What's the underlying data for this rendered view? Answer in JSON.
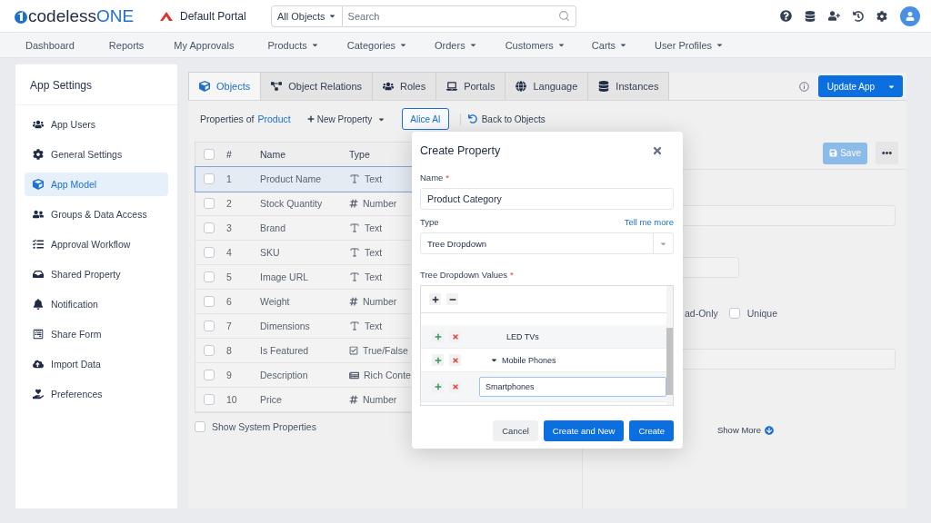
{
  "header": {
    "logo": {
      "main": "codeless",
      "accent": "ONE"
    },
    "portal": "Default Portal",
    "search": {
      "scope": "All Objects",
      "placeholder": "Search"
    }
  },
  "nav": [
    {
      "label": "Dashboard",
      "dropdown": false
    },
    {
      "label": "Reports",
      "dropdown": false
    },
    {
      "label": "My Approvals",
      "dropdown": false
    },
    {
      "label": "Products",
      "dropdown": true
    },
    {
      "label": "Categories",
      "dropdown": true
    },
    {
      "label": "Orders",
      "dropdown": true
    },
    {
      "label": "Customers",
      "dropdown": true
    },
    {
      "label": "Carts",
      "dropdown": true
    },
    {
      "label": "User Profiles",
      "dropdown": true
    }
  ],
  "sidebar": {
    "title": "App Settings",
    "items": [
      {
        "label": "App Users",
        "selected": false
      },
      {
        "label": "General Settings",
        "selected": false
      },
      {
        "label": "App Model",
        "selected": true
      },
      {
        "label": "Groups & Data Access",
        "selected": false
      },
      {
        "label": "Approval Workflow",
        "selected": false
      },
      {
        "label": "Shared Property",
        "selected": false
      },
      {
        "label": "Notification",
        "selected": false
      },
      {
        "label": "Share Form",
        "selected": false
      },
      {
        "label": "Import Data",
        "selected": false
      },
      {
        "label": "Preferences",
        "selected": false
      }
    ]
  },
  "tabs": [
    {
      "label": "Objects",
      "selected": true
    },
    {
      "label": "Object Relations",
      "selected": false
    },
    {
      "label": "Roles",
      "selected": false
    },
    {
      "label": "Portals",
      "selected": false
    },
    {
      "label": "Language",
      "selected": false
    },
    {
      "label": "Instances",
      "selected": false
    }
  ],
  "update_button": "Update App",
  "toolbar": {
    "prefix": "Properties of",
    "object": "Product",
    "new_property": "New Property",
    "ai_button": "Alice AI",
    "back": "Back to Objects"
  },
  "table": {
    "all_checked": false,
    "columns": [
      "#",
      "Name",
      "Type"
    ],
    "rows": [
      {
        "index": "1",
        "name": "Product Name",
        "type": "Text",
        "kind": "text",
        "checked": false,
        "selected": true
      },
      {
        "index": "2",
        "name": "Stock Quantity",
        "type": "Number",
        "kind": "number",
        "checked": false,
        "selected": false
      },
      {
        "index": "3",
        "name": "Brand",
        "type": "Text",
        "kind": "text",
        "checked": false,
        "selected": false
      },
      {
        "index": "4",
        "name": "SKU",
        "type": "Text",
        "kind": "text",
        "checked": false,
        "selected": false
      },
      {
        "index": "5",
        "name": "Image URL",
        "type": "Text",
        "kind": "text",
        "checked": false,
        "selected": false
      },
      {
        "index": "6",
        "name": "Weight",
        "type": "Number",
        "kind": "number",
        "checked": false,
        "selected": false
      },
      {
        "index": "7",
        "name": "Dimensions",
        "type": "Text",
        "kind": "text",
        "checked": false,
        "selected": false
      },
      {
        "index": "8",
        "name": "Is Featured",
        "type": "True/False",
        "kind": "bool",
        "checked": false,
        "selected": false
      },
      {
        "index": "9",
        "name": "Description",
        "type": "Rich Conte",
        "kind": "rich",
        "checked": false,
        "selected": false
      },
      {
        "index": "10",
        "name": "Price",
        "type": "Number",
        "kind": "number",
        "checked": false,
        "selected": false
      }
    ]
  },
  "show_system": {
    "label": "Show System Properties",
    "checked": false
  },
  "detail": {
    "save": "Save",
    "read_only_tail": "ad-Only",
    "unique": {
      "label": "Unique",
      "checked": false
    },
    "show_more": "Show More"
  },
  "dialog": {
    "title": "Create Property",
    "name_label": "Name",
    "name_required": "*",
    "name_value": "Product Category",
    "type_label": "Type",
    "help_link": "Tell me more",
    "type_value": "Tree Dropdown",
    "values_label": "Tree Dropdown Values",
    "values_required": "*",
    "tree": [
      {
        "label": "LED TVs",
        "kind": "text"
      },
      {
        "label": "Mobile Phones",
        "kind": "text",
        "expanded": true,
        "children": [
          {
            "label": "Smartphones",
            "kind": "input"
          }
        ]
      }
    ],
    "buttons": [
      {
        "label": "Cancel",
        "kind": "secondary"
      },
      {
        "label": "Create and New",
        "kind": "primary"
      },
      {
        "label": "Create",
        "kind": "primary"
      }
    ]
  }
}
